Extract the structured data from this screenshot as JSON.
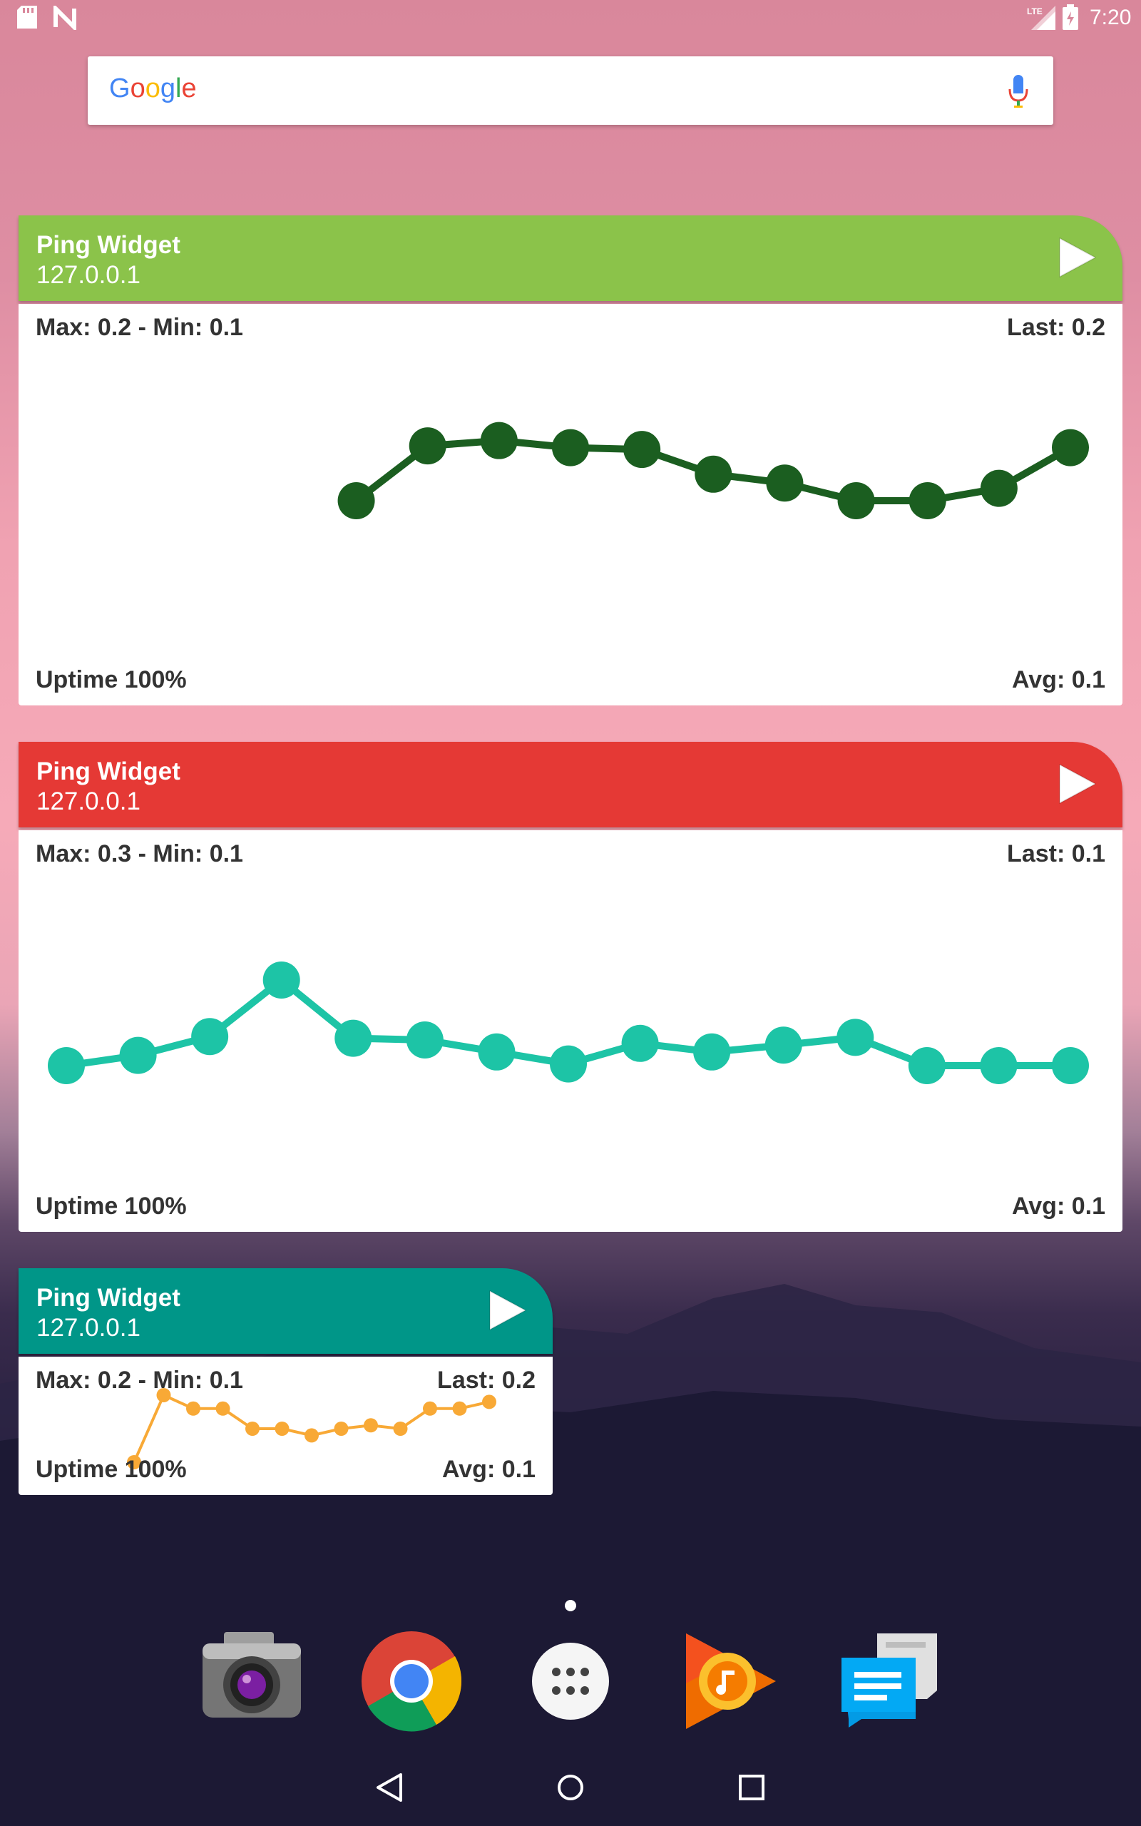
{
  "status_bar": {
    "time": "7:20",
    "network_label": "LTE"
  },
  "search": {
    "logo_letters": [
      {
        "ch": "G",
        "color": "#4285F4"
      },
      {
        "ch": "o",
        "color": "#EA4335"
      },
      {
        "ch": "o",
        "color": "#FBBC05"
      },
      {
        "ch": "g",
        "color": "#4285F4"
      },
      {
        "ch": "l",
        "color": "#34A853"
      },
      {
        "ch": "e",
        "color": "#EA4335"
      }
    ]
  },
  "widgets": [
    {
      "title": "Ping Widget",
      "host": "127.0.0.1",
      "header_color": "#8BC34A",
      "max_min": "Max: 0.2 - Min: 0.1",
      "last": "Last: 0.2",
      "uptime": "Uptime 100%",
      "avg": "Avg: 0.1",
      "series_color": "#1B5E20"
    },
    {
      "title": "Ping Widget",
      "host": "127.0.0.1",
      "header_color": "#E53935",
      "max_min": "Max: 0.3 - Min: 0.1",
      "last": "Last: 0.1",
      "uptime": "Uptime 100%",
      "avg": "Avg: 0.1",
      "series_color": "#1DC4A6"
    },
    {
      "title": "Ping Widget",
      "host": "127.0.0.1",
      "header_color": "#009688",
      "max_min": "Max: 0.2 - Min: 0.1",
      "last": "Last: 0.2",
      "uptime": "Uptime 100%",
      "avg": "Avg: 0.1",
      "series_color": "#F8A936"
    }
  ],
  "chart_data": [
    {
      "type": "line",
      "x": [
        5,
        6,
        7,
        8,
        9,
        10,
        11,
        12,
        13,
        14,
        15
      ],
      "values": [
        0.1,
        0.162,
        0.168,
        0.16,
        0.158,
        0.13,
        0.12,
        0.1,
        0.1,
        0.114,
        0.16
      ],
      "xlim": [
        1,
        15
      ],
      "ylim": [
        0.0,
        0.25
      ]
    },
    {
      "type": "line",
      "x": [
        1,
        2,
        3,
        4,
        5,
        6,
        7,
        8,
        9,
        10,
        11,
        12,
        13,
        14,
        15
      ],
      "values": [
        0.1,
        0.112,
        0.134,
        0.2,
        0.132,
        0.13,
        0.116,
        0.102,
        0.126,
        0.116,
        0.124,
        0.133,
        0.1,
        0.1,
        0.1
      ],
      "xlim": [
        1,
        15
      ],
      "ylim": [
        0.0,
        0.3
      ]
    },
    {
      "type": "line",
      "x": [
        1,
        2,
        3,
        4,
        5,
        6,
        7,
        8,
        9,
        10,
        11,
        12,
        13
      ],
      "values": [
        0.1,
        0.2,
        0.18,
        0.18,
        0.15,
        0.15,
        0.14,
        0.15,
        0.155,
        0.15,
        0.18,
        0.18,
        0.19
      ],
      "xlim": [
        1,
        13
      ],
      "ylim": [
        0.1,
        0.2
      ]
    }
  ],
  "dock": [
    {
      "name": "camera-app-icon"
    },
    {
      "name": "chrome-app-icon"
    },
    {
      "name": "app-drawer-icon"
    },
    {
      "name": "play-music-app-icon"
    },
    {
      "name": "messenger-app-icon"
    }
  ]
}
